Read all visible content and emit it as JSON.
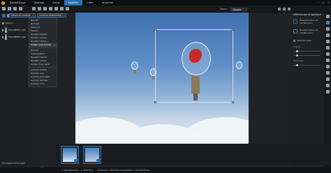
{
  "app": {
    "title": "PhotoDirector",
    "menu_tabs": [
      "Bibliothèque",
      "Réglage",
      "Guide",
      "Modifier",
      "Créer",
      "Imprimer"
    ],
    "active_tab_index": 3,
    "accent_color": "#2a6fb0"
  },
  "toolbar": {
    "zoom_label": "Zoom :",
    "zoom_value": "Adapter"
  },
  "library_panel": {
    "album_select": "Album du module",
    "sort_select": "Contenu sélectionné",
    "album_items": [
      {
        "label": "Aperçu"
      },
      {
        "label": "FRAGMENT-1.JPG"
      },
      {
        "label": "FRAGMENT-2.JPG"
      }
    ],
    "export_link": "Enregistrer/Partager"
  },
  "dropdown": {
    "items_group1": [
      "Normal",
      "Normale",
      "Obscurcir",
      "Produit",
      "Densité linéaire -",
      "Densité couleur -",
      "Densité linéaire +",
      "Couleur plus foncée"
    ],
    "highlighted": "Couleur plus foncée",
    "items_group2": [
      "Éclaircir",
      "Superposition",
      "Densité linéaire",
      "Densité couleur",
      "Couleur plus claire"
    ],
    "items_group3": [
      "Lumière linéaire",
      "Lumière vive",
      "Lumière ponctuelle",
      "Lumière tamisée",
      "Lumière crue"
    ]
  },
  "right_panel": {
    "title": "Sélectionner et Appliquer",
    "options": [
      {
        "label": "Transformation de l'arrière-plan"
      },
      {
        "label": "Transformation de l'arrière-plan"
      }
    ],
    "checkbox_label": "Sélection auto",
    "section1": "Aligner",
    "section2": "Estomper"
  },
  "filmstrip": {
    "cancel_label": "Effacer"
  },
  "status_bar": {
    "items": [
      "1 sélectionné(s) - 2 affiché(s)",
      "Collection : Dernière importation | 20150208.jpg"
    ]
  }
}
